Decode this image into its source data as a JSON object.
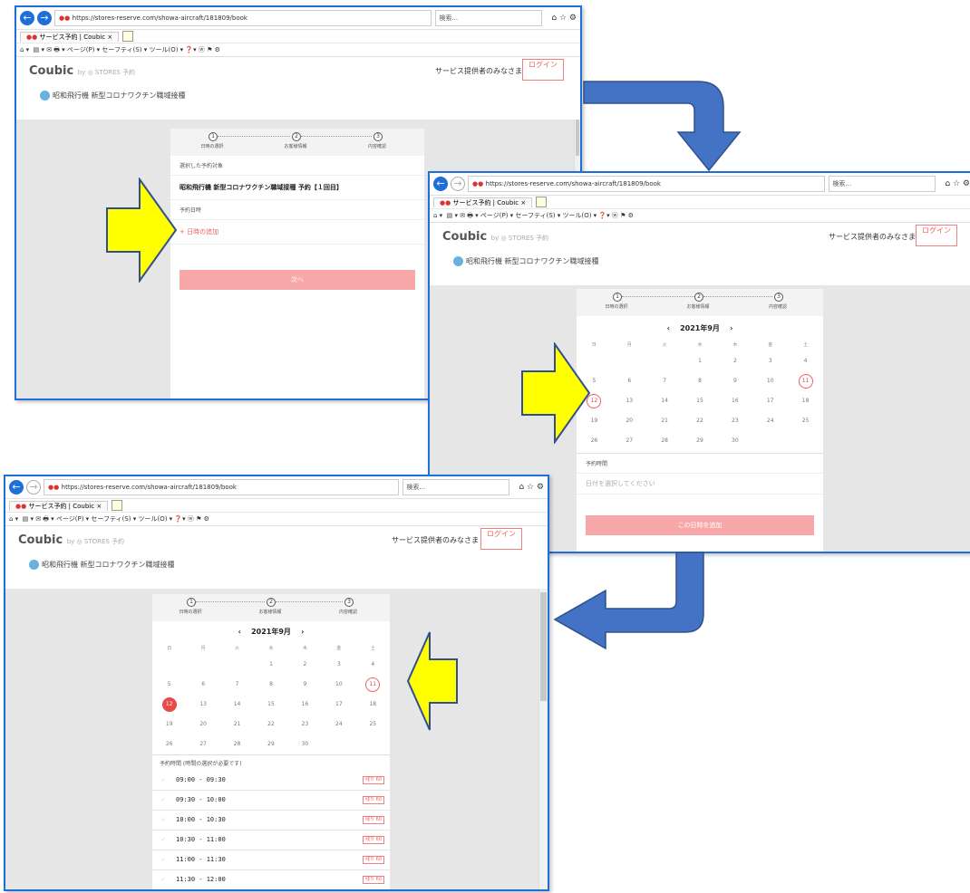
{
  "browser": {
    "url1": "https://stores-reserve.com/showa-aircraft/181809/book",
    "url2": "https://stores-reserve.com/showa-aircraft/181809/book",
    "url3": "https://stores-reserve.com/showa-aircraft/181809/book",
    "search_placeholder": "検索...",
    "tab_title": "サービス予約 | Coubic",
    "cmd_page": "ページ(P) ▾",
    "cmd_safety": "セーフティ(S) ▾",
    "cmd_tools": "ツール(O) ▾"
  },
  "site": {
    "logo": "Coubic",
    "logo_by": "by ◎ STORES 予約",
    "provider_link": "サービス提供者のみなさま",
    "login": "ログイン",
    "service_name": "昭和飛行機 新型コロナワクチン職域接種"
  },
  "steps": [
    "日時の選択",
    "お客様情報",
    "内容確認"
  ],
  "screen1": {
    "selected_label": "選択した予約対象",
    "selected_value": "昭和飛行機 新型コロナワクチン職域接種 予約【１回目】",
    "date_label": "予約日時",
    "add_date": "+ 日時の追加",
    "next": "次へ"
  },
  "calendar": {
    "month": "2021年9月",
    "prev": "‹",
    "next": "›",
    "dow": [
      "日",
      "月",
      "火",
      "水",
      "木",
      "金",
      "土"
    ],
    "weeks": [
      [
        "",
        "",
        "",
        "1",
        "2",
        "3",
        "4"
      ],
      [
        "5",
        "6",
        "7",
        "8",
        "9",
        "10",
        "11"
      ],
      [
        "12",
        "13",
        "14",
        "15",
        "16",
        "17",
        "18"
      ],
      [
        "19",
        "20",
        "21",
        "22",
        "23",
        "24",
        "25"
      ],
      [
        "26",
        "27",
        "28",
        "29",
        "30",
        "",
        ""
      ]
    ],
    "today": "11",
    "selected": "12"
  },
  "screen2": {
    "time_label": "予約時間",
    "time_placeholder": "日付を選択してください",
    "add_button": "この日時を追加"
  },
  "screen3": {
    "time_label": "予約時間 (時間の選択が必要です)",
    "slots": [
      {
        "time": "09:00 - 09:30",
        "badge": "残り 60"
      },
      {
        "time": "09:30 - 10:00",
        "badge": "残り 60"
      },
      {
        "time": "10:00 - 10:30",
        "badge": "残り 60"
      },
      {
        "time": "10:30 - 11:00",
        "badge": "残り 60"
      },
      {
        "time": "11:00 - 11:30",
        "badge": "残り 60"
      },
      {
        "time": "11:30 - 12:00",
        "badge": "残り 60"
      }
    ]
  },
  "colors": {
    "accent": "#f06060",
    "arrow_yellow": "#ffff00",
    "arrow_blue": "#4472c4",
    "window_border": "#1e6fd9"
  }
}
